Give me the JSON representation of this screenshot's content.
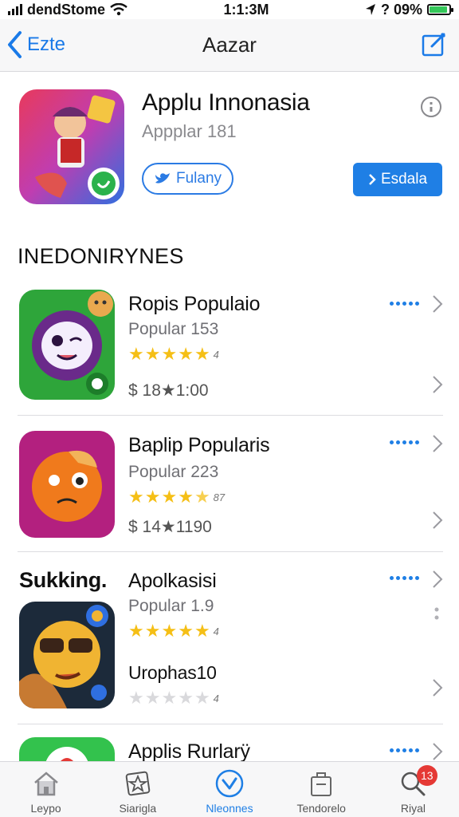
{
  "status_bar": {
    "carrier": "dendStome",
    "time": "1:1:3M",
    "battery_text": "? 09%",
    "battery_level": 0.9
  },
  "nav": {
    "back_label": "Ezte",
    "title": "Aazar"
  },
  "featured": {
    "title": "Applu Innonasia",
    "subtitle": "Appplar 181",
    "share_label": "Fulany",
    "get_label": "Esdala"
  },
  "section": {
    "header": "INEDONIRYNES"
  },
  "apps": [
    {
      "name": "Ropis Populaio",
      "subtitle": "Popular 153",
      "rating": 5,
      "rating_count": "4",
      "price": "$ 18★1:00",
      "prefix": "",
      "extra": ""
    },
    {
      "name": "Baplip Popularis",
      "subtitle": "Popular 223",
      "rating": 4.5,
      "rating_count": "87",
      "price": "$ 14★1190",
      "prefix": "",
      "extra": ""
    },
    {
      "name": "Apolkasisi",
      "subtitle": "Popular 1.9",
      "rating": 5,
      "rating_count": "4",
      "price": "",
      "prefix": "Sukking.",
      "extra": "Urophas10",
      "extra_rating_count": "4"
    },
    {
      "name": "Applis Rurlarÿ"
    }
  ],
  "tabs": [
    {
      "label": "Leypo",
      "icon": "home-icon"
    },
    {
      "label": "Siarigla",
      "icon": "star-box-icon"
    },
    {
      "label": "Nleonnes",
      "icon": "check-circle-icon",
      "active": true
    },
    {
      "label": "Tendorelo",
      "icon": "bag-icon"
    },
    {
      "label": "Riyal",
      "icon": "search-icon",
      "badge": "13"
    }
  ],
  "colors": {
    "accent": "#1f7fe5",
    "star": "#f5bf16",
    "badge": "#e53935"
  }
}
